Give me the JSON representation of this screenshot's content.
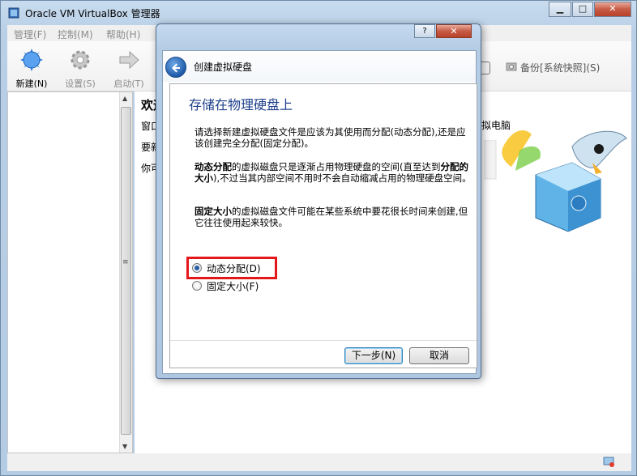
{
  "window": {
    "title": "Oracle VM VirtualBox 管理器",
    "min": "▁",
    "max": "□",
    "close": "✕"
  },
  "menu": [
    {
      "label": "管理(F)"
    },
    {
      "label": "控制(M)"
    },
    {
      "label": "帮助(H)"
    }
  ],
  "toolbar": {
    "new_label": "新建(N)",
    "settings_label": "设置(S)",
    "start_label": "启动(T)",
    "snapshot_label": "备份[系统快照](S)"
  },
  "welcome": {
    "title": "欢迎",
    "line1": "窗口",
    "line2": "要新",
    "line3": "你可",
    "right_text": "拟电脑"
  },
  "dialog": {
    "help": "?",
    "close": "✕",
    "title": "创建虚拟硬盘",
    "page_title": "存储在物理硬盘上",
    "para1": "请选择新建虚拟硬盘文件是应该为其使用而分配(动态分配),还是应该创建完全分配(固定分配)。",
    "para2_bold": "动态分配",
    "para2_a": "的虚拟磁盘只是逐渐占用物理硬盘的空间(直至达到",
    "para2_bold2": "分配的大小",
    "para2_b": "),不过当其内部空间不用时不会自动缩减占用的物理硬盘空间。",
    "para3_bold": "固定大小",
    "para3_a": "的虚拟磁盘文件可能在某些系统中要花很长时间来创建,但它往往使用起来较快。",
    "option_dynamic": "动态分配(D)",
    "option_fixed": "固定大小(F)",
    "selected": "dynamic",
    "next_label": "下一步(N)",
    "cancel_label": "取消"
  }
}
